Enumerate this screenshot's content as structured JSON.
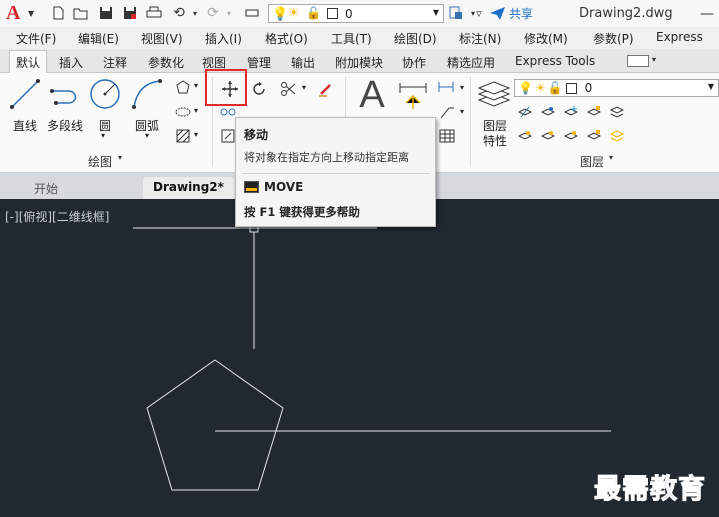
{
  "titlebar": {
    "app_letter": "A",
    "current_layer": "0",
    "share_label": "共享",
    "document_title": "Drawing2.dwg"
  },
  "menu": [
    "文件(F)",
    "编辑(E)",
    "视图(V)",
    "插入(I)",
    "格式(O)",
    "工具(T)",
    "绘图(D)",
    "标注(N)",
    "修改(M)",
    "参数(P)",
    "Express"
  ],
  "ribbon_tabs": [
    "默认",
    "插入",
    "注释",
    "参数化",
    "视图",
    "管理",
    "输出",
    "附加模块",
    "协作",
    "精选应用",
    "Express Tools"
  ],
  "ribbon": {
    "draw_tools": [
      "直线",
      "多段线",
      "圆",
      "圆弧"
    ],
    "draw_panel_title": "绘图",
    "layer_props_label": [
      "图层",
      "特性"
    ],
    "layer_current": "0",
    "layer_panel_title": "图层"
  },
  "file_tabs": [
    "开始",
    "Drawing2*"
  ],
  "viewport_label": "[-][俯视][二维线框]",
  "tooltip": {
    "title": "移动",
    "description": "将对象在指定方向上移动指定距离",
    "command": "MOVE",
    "help": "按 F1 键获得更多帮助"
  },
  "watermark": "最需教育",
  "colors": {
    "canvas": "#212830",
    "highlight": "#e32b2b",
    "accent": "#1a6fc9"
  }
}
